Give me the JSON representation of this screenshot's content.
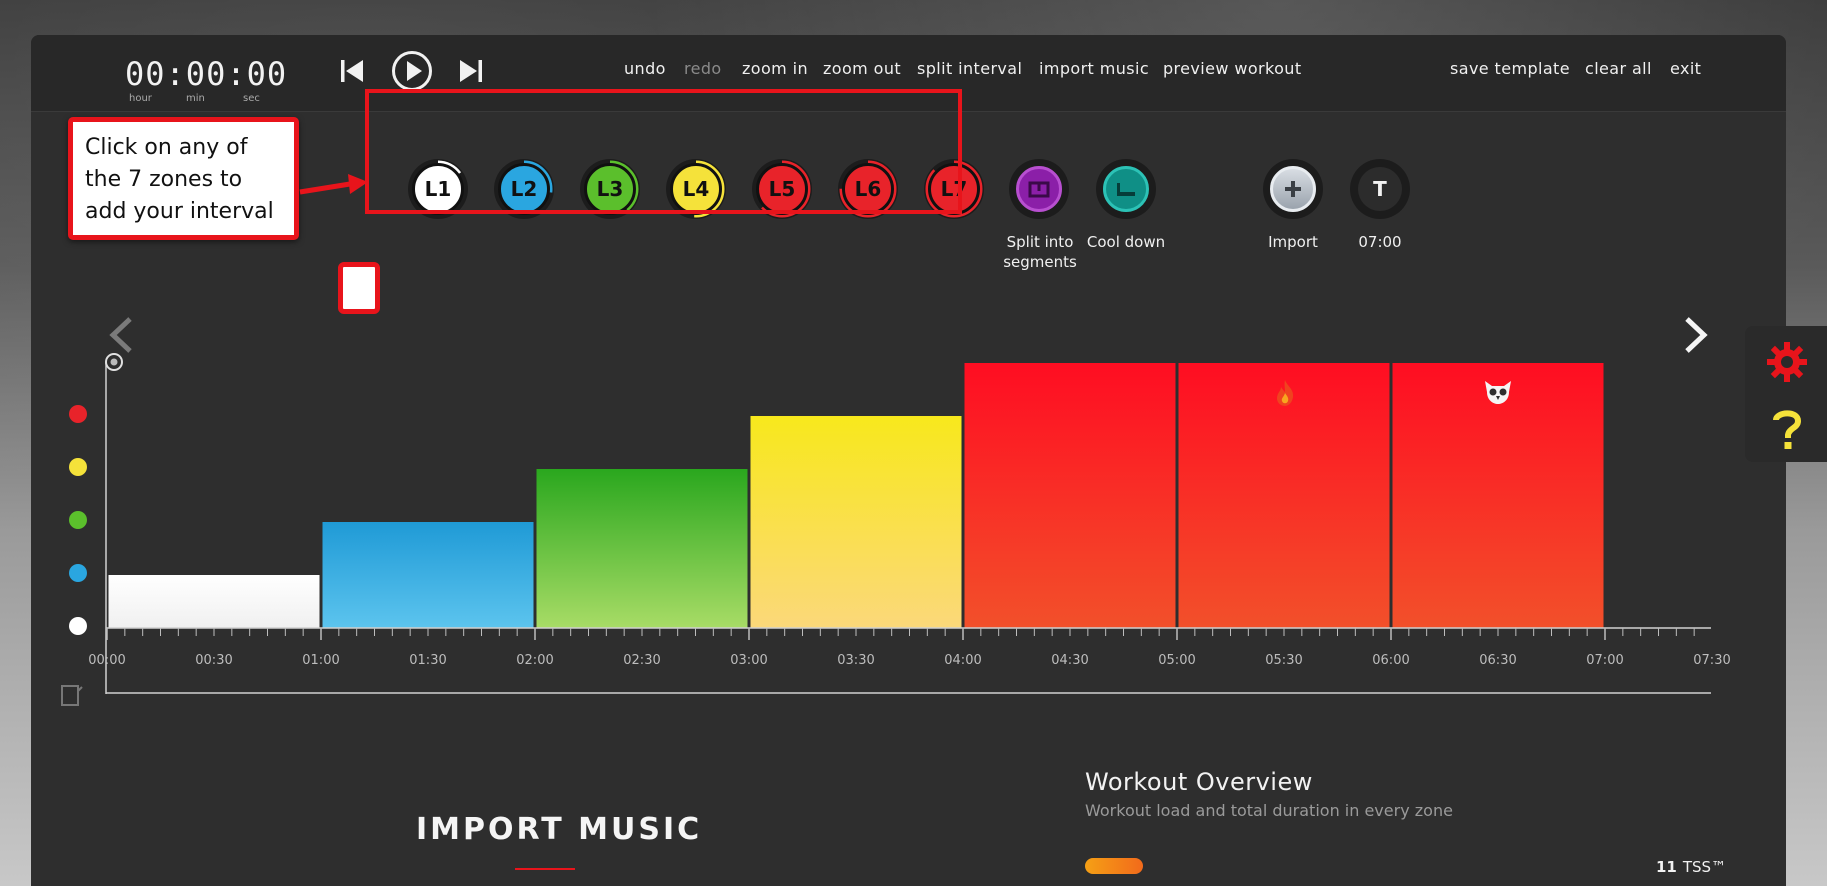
{
  "timer": {
    "value": "00:00:00",
    "hour_label": "hour",
    "min_label": "min",
    "sec_label": "sec"
  },
  "menu": {
    "undo": "undo",
    "redo": "redo",
    "zoom_in": "zoom in",
    "zoom_out": "zoom out",
    "split_interval": "split interval",
    "import_music": "import music",
    "preview_workout": "preview workout",
    "save_template": "save template",
    "clear_all": "clear all",
    "exit": "exit"
  },
  "zones": [
    {
      "label": "L1",
      "color": "#ffffff",
      "ring": "#ffffff",
      "text": "#111111"
    },
    {
      "label": "L2",
      "color": "#2aa6e0",
      "ring": "#2aa6e0",
      "text": "#111111"
    },
    {
      "label": "L3",
      "color": "#5bbf2c",
      "ring": "#5bbf2c",
      "text": "#111111"
    },
    {
      "label": "L4",
      "color": "#f5e23a",
      "ring": "#f5e23a",
      "text": "#111111"
    },
    {
      "label": "L5",
      "color": "#e8232a",
      "ring": "#e8232a",
      "text": "#111111"
    },
    {
      "label": "L6",
      "color": "#e8232a",
      "ring": "#e8232a",
      "text": "#111111"
    },
    {
      "label": "L7",
      "color": "#e8232a",
      "ring": "#e8232a",
      "text": "#111111"
    }
  ],
  "tools": {
    "split": "Split into segments",
    "split_line1": "Split into",
    "split_line2": "segments",
    "cooldown": "Cool down",
    "import": "Import",
    "text_icon_letter": "T",
    "text_time": "07:00"
  },
  "callout": "Click on any of the 7 zones to add your interval",
  "chart_data": {
    "type": "bar",
    "x_unit": "mm:ss",
    "ticks": [
      "00:00",
      "00:30",
      "01:00",
      "01:30",
      "02:00",
      "02:30",
      "03:00",
      "03:30",
      "04:00",
      "04:30",
      "05:00",
      "05:30",
      "06:00",
      "06:30",
      "07:00",
      "07:30"
    ],
    "intervals": [
      {
        "start": "00:00",
        "end": "01:00",
        "zone": "L1",
        "level": 1
      },
      {
        "start": "01:00",
        "end": "02:00",
        "zone": "L2",
        "level": 2
      },
      {
        "start": "02:00",
        "end": "03:00",
        "zone": "L3",
        "level": 3
      },
      {
        "start": "03:00",
        "end": "04:00",
        "zone": "L4",
        "level": 4
      },
      {
        "start": "04:00",
        "end": "05:00",
        "zone": "L5",
        "level": 5
      },
      {
        "start": "05:00",
        "end": "06:00",
        "zone": "L6",
        "level": 5
      },
      {
        "start": "06:00",
        "end": "07:00",
        "zone": "L7",
        "level": 5
      }
    ],
    "level_dot_colors": [
      "#e8232a",
      "#f5e23a",
      "#5bbf2c",
      "#2aa6e0",
      "#ffffff"
    ]
  },
  "import_music": {
    "title": "IMPORT MUSIC"
  },
  "overview": {
    "title": "Workout Overview",
    "subtitle": "Workout load and total duration in every zone",
    "tss_value": "11",
    "tss_label": "TSS™"
  }
}
